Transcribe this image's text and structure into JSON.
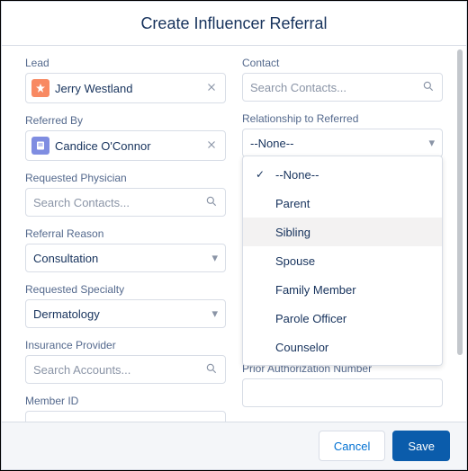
{
  "title": "Create Influencer Referral",
  "left": {
    "lead": {
      "label": "Lead",
      "value": "Jerry Westland"
    },
    "referredBy": {
      "label": "Referred By",
      "value": "Candice O'Connor"
    },
    "reqPhys": {
      "label": "Requested Physician",
      "placeholder": "Search Contacts..."
    },
    "reason": {
      "label": "Referral Reason",
      "value": "Consultation"
    },
    "specialty": {
      "label": "Requested Specialty",
      "value": "Dermatology"
    },
    "insurance": {
      "label": "Insurance Provider",
      "placeholder": "Search Accounts..."
    },
    "memberId": {
      "label": "Member ID",
      "value": ""
    }
  },
  "right": {
    "contact": {
      "label": "Contact",
      "placeholder": "Search Contacts..."
    },
    "relationship": {
      "label": "Relationship to Referred",
      "value": "--None--",
      "options": [
        "--None--",
        "Parent",
        "Sibling",
        "Spouse",
        "Family Member",
        "Parole Officer",
        "Counselor"
      ],
      "selected": "--None--",
      "highlighted": "Sibling"
    },
    "priorAuth": {
      "label": "Prior Authorization Number",
      "value": ""
    }
  },
  "footer": {
    "cancel": "Cancel",
    "save": "Save"
  }
}
